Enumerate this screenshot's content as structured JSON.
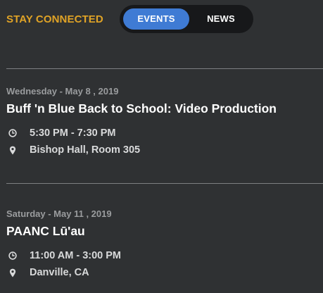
{
  "header": {
    "title": "STAY CONNECTED",
    "tabs": [
      {
        "label": "EVENTS",
        "active": true
      },
      {
        "label": "NEWS",
        "active": false
      }
    ],
    "accent_color": "#e0a326",
    "active_tab_color": "#3f7bd4"
  },
  "events": [
    {
      "date": "Wednesday - May 8 , 2019",
      "title": "Buff 'n Blue Back to School: Video Production",
      "time": "5:30 PM - 7:30 PM",
      "location": "Bishop Hall, Room 305",
      "time_icon": "clock-icon",
      "location_icon": "map-pin-icon"
    },
    {
      "date": "Saturday - May 11 , 2019",
      "title": "PAANC Lū'au",
      "time": "11:00 AM - 3:00 PM",
      "location": "Danville, CA",
      "time_icon": "clock-icon",
      "location_icon": "map-pin-icon"
    }
  ]
}
